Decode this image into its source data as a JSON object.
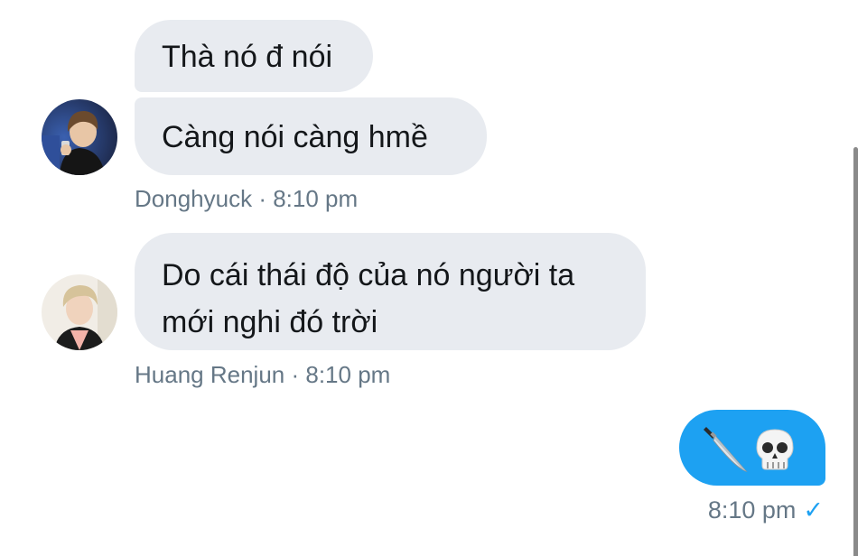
{
  "messages": [
    {
      "text": "Thà nó đ nói"
    },
    {
      "text": "Càng nói càng hmề"
    },
    {
      "lines": [
        "Do cái thái độ của nó người ta",
        "mới nghi đó trời"
      ]
    }
  ],
  "meta": [
    {
      "author": "Donghyuck",
      "separator": "·",
      "time": "8:10 pm"
    },
    {
      "author": "Huang Renjun",
      "separator": "·",
      "time": "8:10 pm"
    }
  ],
  "sent": {
    "icons": [
      "knife-icon",
      "skull-icon"
    ],
    "time": "8:10 pm",
    "status_mark": "✓"
  },
  "colors": {
    "received_bubble": "#e8ebf0",
    "sent_bubble": "#1da1f2",
    "meta_text": "#657786"
  }
}
